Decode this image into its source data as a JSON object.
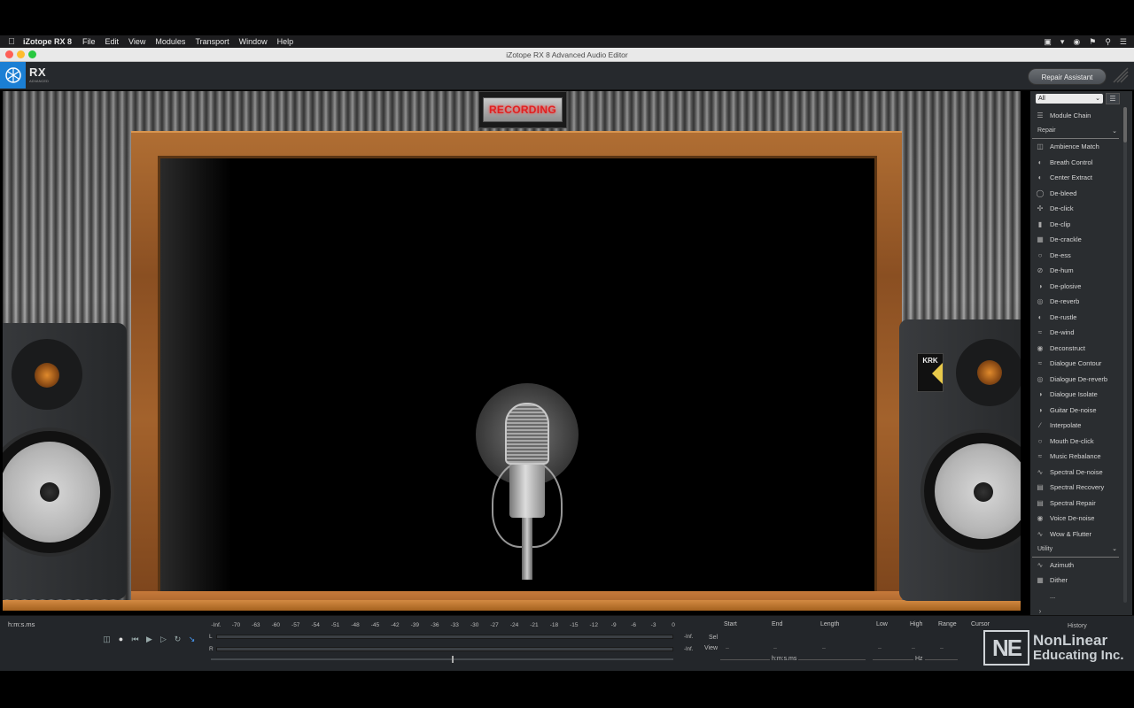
{
  "menubar": {
    "app_name": "iZotope RX 8",
    "items": [
      "File",
      "Edit",
      "View",
      "Modules",
      "Transport",
      "Window",
      "Help"
    ],
    "status_icons": [
      "screen-record-icon",
      "cast-icon",
      "wifi-icon",
      "flag-icon",
      "search-icon",
      "control-center-icon"
    ]
  },
  "window": {
    "title": "iZotope RX 8 Advanced Audio Editor"
  },
  "header": {
    "logo_text": "RX",
    "logo_subtext": "ADVANCED",
    "repair_assistant_label": "Repair Assistant"
  },
  "studio": {
    "sign_text": "RECORDING",
    "speaker_brand": "KRK"
  },
  "sidebar": {
    "filter_value": "All",
    "module_chain_label": "Module Chain",
    "sections": [
      {
        "name": "Repair",
        "items": [
          "Ambience Match",
          "Breath Control",
          "Center Extract",
          "De-bleed",
          "De-click",
          "De-clip",
          "De-crackle",
          "De-ess",
          "De-hum",
          "De-plosive",
          "De-reverb",
          "De-rustle",
          "De-wind",
          "Deconstruct",
          "Dialogue Contour",
          "Dialogue De-reverb",
          "Dialogue Isolate",
          "Guitar De-noise",
          "Interpolate",
          "Mouth De-click",
          "Music Rebalance",
          "Spectral De-noise",
          "Spectral Recovery",
          "Spectral Repair",
          "Voice De-noise",
          "Wow & Flutter"
        ]
      },
      {
        "name": "Utility",
        "items": [
          "Azimuth",
          "Dither"
        ]
      }
    ],
    "more_indicator": "...",
    "expand_label": "›"
  },
  "bottom": {
    "time_format": "h:m:s.ms",
    "meter_scale": [
      "-Inf.",
      "-70",
      "-63",
      "-60",
      "-57",
      "-54",
      "-51",
      "-48",
      "-45",
      "-42",
      "-39",
      "-36",
      "-33",
      "-30",
      "-27",
      "-24",
      "-21",
      "-18",
      "-15",
      "-12",
      "-9",
      "-6",
      "-3",
      "0"
    ],
    "channel_l": "L",
    "channel_r": "R",
    "meter_l_value": "-Inf.",
    "meter_r_value": "-Inf.",
    "selection": {
      "headers": [
        "Start",
        "End",
        "Length",
        "Low",
        "High",
        "Range",
        "Cursor"
      ],
      "row_sel": "Sel",
      "row_view": "View",
      "empty": "–",
      "time_units": "h:m:s.ms",
      "freq_units": "Hz"
    },
    "history_label": "History"
  },
  "watermark": {
    "box_text": "NE",
    "line1": "NonLinear",
    "line2": "Educating Inc."
  },
  "colors": {
    "accent": "#1b7fd4",
    "recording": "#e02020",
    "sidebar_bg": "#2a2d30"
  }
}
